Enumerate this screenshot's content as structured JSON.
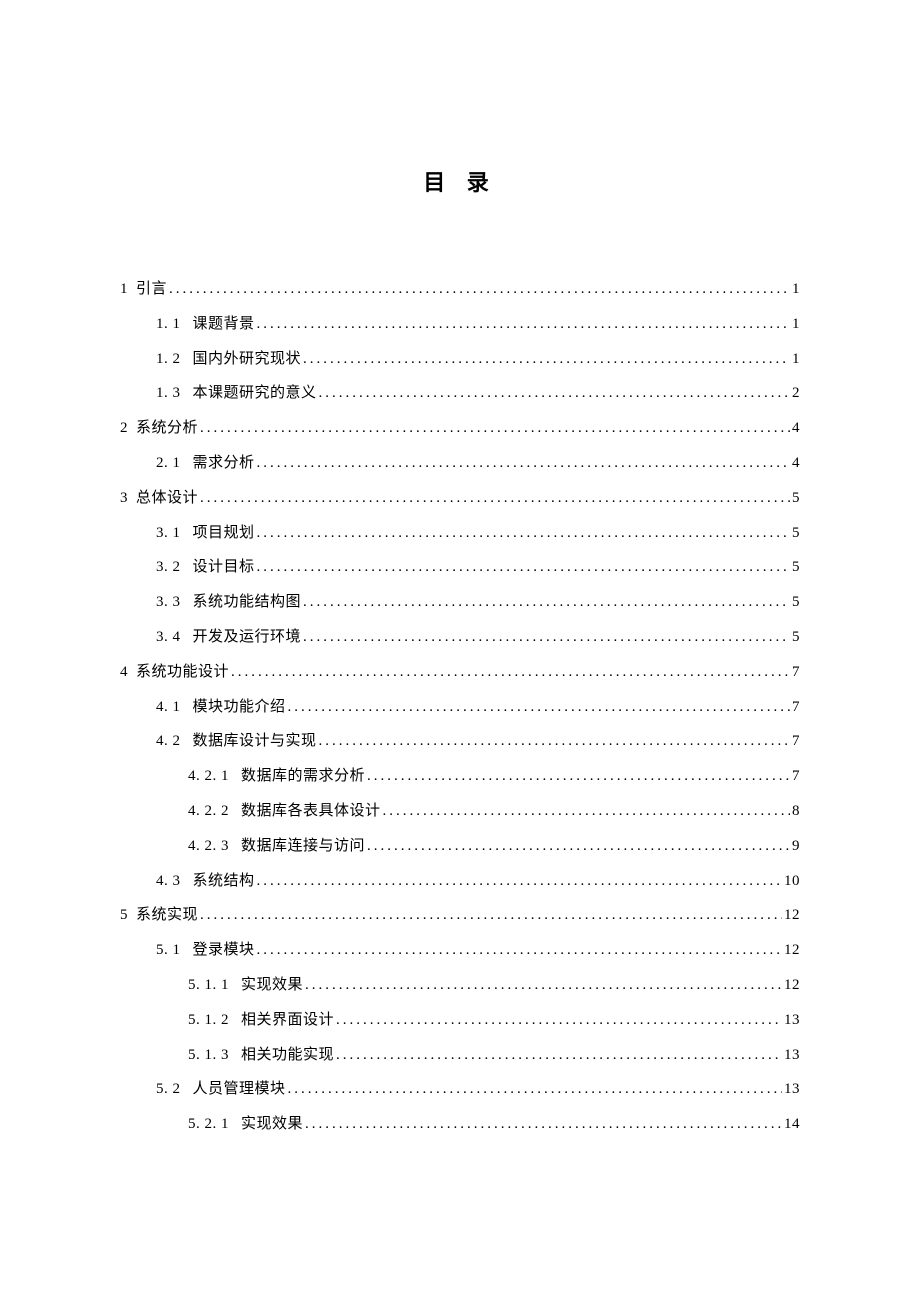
{
  "title": "目 录",
  "entries": [
    {
      "level": 1,
      "num": "1",
      "text": "引言",
      "page": "1"
    },
    {
      "level": 2,
      "num": "1. 1",
      "text": "课题背景",
      "page": "1"
    },
    {
      "level": 2,
      "num": "1. 2",
      "text": "国内外研究现状",
      "page": "1"
    },
    {
      "level": 2,
      "num": "1. 3",
      "text": "本课题研究的意义",
      "page": "2"
    },
    {
      "level": 1,
      "num": "2",
      "text": "系统分析",
      "page": "4"
    },
    {
      "level": 2,
      "num": "2. 1",
      "text": "需求分析",
      "page": "4"
    },
    {
      "level": 1,
      "num": "3",
      "text": "总体设计",
      "page": "5"
    },
    {
      "level": 2,
      "num": "3. 1",
      "text": "项目规划",
      "page": "5"
    },
    {
      "level": 2,
      "num": "3. 2",
      "text": "设计目标",
      "page": "5"
    },
    {
      "level": 2,
      "num": "3. 3",
      "text": "系统功能结构图",
      "page": "5"
    },
    {
      "level": 2,
      "num": "3. 4",
      "text": "开发及运行环境",
      "page": "5"
    },
    {
      "level": 1,
      "num": "4",
      "text": "系统功能设计",
      "page": "7"
    },
    {
      "level": 2,
      "num": "4. 1",
      "text": "模块功能介绍",
      "page": "7"
    },
    {
      "level": 2,
      "num": "4. 2",
      "text": "数据库设计与实现",
      "page": "7"
    },
    {
      "level": 3,
      "num": "4. 2. 1",
      "text": "数据库的需求分析",
      "page": "7"
    },
    {
      "level": 3,
      "num": "4. 2. 2",
      "text": "数据库各表具体设计",
      "page": "8"
    },
    {
      "level": 3,
      "num": "4. 2. 3",
      "text": "数据库连接与访问",
      "page": "9"
    },
    {
      "level": 2,
      "num": "4. 3",
      "text": "系统结构",
      "page": "10"
    },
    {
      "level": 1,
      "num": "5",
      "text": "系统实现",
      "page": "12"
    },
    {
      "level": 2,
      "num": "5. 1",
      "text": "登录模块",
      "page": "12"
    },
    {
      "level": 3,
      "num": "5. 1. 1",
      "text": "实现效果",
      "page": "12"
    },
    {
      "level": 3,
      "num": "5. 1. 2",
      "text": "相关界面设计",
      "page": "13"
    },
    {
      "level": 3,
      "num": "5. 1. 3",
      "text": "相关功能实现",
      "page": "13"
    },
    {
      "level": 2,
      "num": "5. 2",
      "text": "人员管理模块",
      "page": "13"
    },
    {
      "level": 3,
      "num": "5. 2. 1",
      "text": "实现效果",
      "page": "14"
    }
  ]
}
